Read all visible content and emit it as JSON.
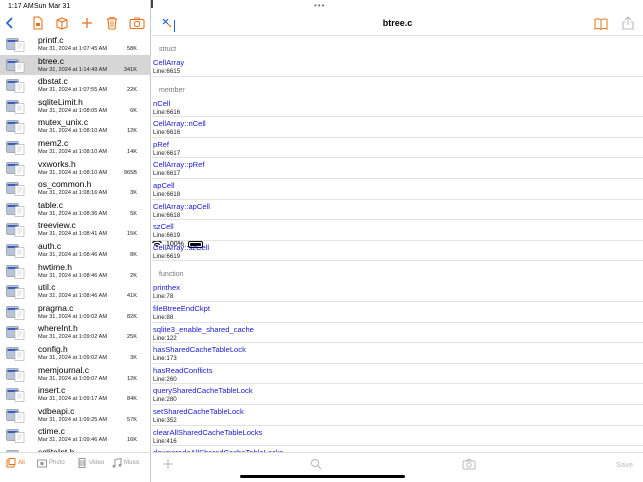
{
  "status": {
    "time": "1:17 AM",
    "date": "Sun Mar 31",
    "battery": "100%"
  },
  "left_toolbar": [
    "back-icon",
    "new-file-icon",
    "package-icon",
    "add-icon",
    "trash-icon",
    "camera-icon"
  ],
  "files": [
    {
      "name": "printf.c",
      "date": "Mar 31, 2024 at 1:07:45 AM",
      "size": "58K",
      "selected": false
    },
    {
      "name": "btree.c",
      "date": "Mar 31, 2024 at 1:14:49 AM",
      "size": "341K",
      "selected": true
    },
    {
      "name": "dbstat.c",
      "date": "Mar 31, 2024 at 1:07:55 AM",
      "size": "22K",
      "selected": false
    },
    {
      "name": "sqliteLimit.h",
      "date": "Mar 31, 2024 at 1:08:05 AM",
      "size": "6K",
      "selected": false
    },
    {
      "name": "mutex_unix.c",
      "date": "Mar 31, 2024 at 1:08:10 AM",
      "size": "12K",
      "selected": false
    },
    {
      "name": "mem2.c",
      "date": "Mar 31, 2024 at 1:08:10 AM",
      "size": "14K",
      "selected": false
    },
    {
      "name": "vxworks.h",
      "date": "Mar 31, 2024 at 1:08:10 AM",
      "size": "965B",
      "selected": false
    },
    {
      "name": "os_common.h",
      "date": "Mar 31, 2024 at 1:08:16 AM",
      "size": "3K",
      "selected": false
    },
    {
      "name": "table.c",
      "date": "Mar 31, 2024 at 1:08:36 AM",
      "size": "5K",
      "selected": false
    },
    {
      "name": "treeview.c",
      "date": "Mar 31, 2024 at 1:08:41 AM",
      "size": "15K",
      "selected": false
    },
    {
      "name": "auth.c",
      "date": "Mar 31, 2024 at 1:08:46 AM",
      "size": "8K",
      "selected": false
    },
    {
      "name": "hwtime.h",
      "date": "Mar 31, 2024 at 1:08:46 AM",
      "size": "2K",
      "selected": false
    },
    {
      "name": "util.c",
      "date": "Mar 31, 2024 at 1:08:46 AM",
      "size": "41K",
      "selected": false
    },
    {
      "name": "pragma.c",
      "date": "Mar 31, 2024 at 1:09:02 AM",
      "size": "82K",
      "selected": false
    },
    {
      "name": "whereInt.h",
      "date": "Mar 31, 2024 at 1:09:02 AM",
      "size": "25K",
      "selected": false
    },
    {
      "name": "config.h",
      "date": "Mar 31, 2024 at 1:09:02 AM",
      "size": "3K",
      "selected": false
    },
    {
      "name": "memjournal.c",
      "date": "Mar 31, 2024 at 1:09:07 AM",
      "size": "12K",
      "selected": false
    },
    {
      "name": "insert.c",
      "date": "Mar 31, 2024 at 1:09:17 AM",
      "size": "84K",
      "selected": false
    },
    {
      "name": "vdbeapi.c",
      "date": "Mar 31, 2024 at 1:09:25 AM",
      "size": "57K",
      "selected": false
    },
    {
      "name": "ctime.c",
      "date": "Mar 31, 2024 at 1:09:46 AM",
      "size": "16K",
      "selected": false
    },
    {
      "name": "sqliteInt.h",
      "date": "",
      "size": "",
      "selected": false
    }
  ],
  "tabs": [
    {
      "label": "All",
      "active": true
    },
    {
      "label": "Photo",
      "active": false
    },
    {
      "label": "Video",
      "active": false
    },
    {
      "label": "Music",
      "active": false
    }
  ],
  "editor": {
    "title": "btree.c",
    "save_label": "Save",
    "sections": [
      {
        "label": "struct",
        "items": [
          {
            "name": "CellArray",
            "line": "Line:6615"
          }
        ]
      },
      {
        "label": "member",
        "items": [
          {
            "name": "nCell",
            "line": "Line:6616"
          },
          {
            "name": "CellArray::nCell",
            "line": "Line:6616"
          },
          {
            "name": "pRef",
            "line": "Line:6617"
          },
          {
            "name": "CellArray::pRef",
            "line": "Line:6617"
          },
          {
            "name": "apCell",
            "line": "Line:6618"
          },
          {
            "name": "CellArray::apCell",
            "line": "Line:6618"
          },
          {
            "name": "szCell",
            "line": "Line:6619"
          },
          {
            "name": "CellArray::szCell",
            "line": "Line:6619"
          }
        ]
      },
      {
        "label": "function",
        "items": [
          {
            "name": "printhex",
            "line": "Line:78"
          },
          {
            "name": "fileBtreeEndCkpt",
            "line": "Line:88"
          },
          {
            "name": "sqlite3_enable_shared_cache",
            "line": "Line:122"
          },
          {
            "name": "hasSharedCacheTableLock",
            "line": "Line:173"
          },
          {
            "name": "hasReadConflicts",
            "line": "Line:260"
          },
          {
            "name": "querySharedCacheTableLock",
            "line": "Line:280"
          },
          {
            "name": "setSharedCacheTableLock",
            "line": "Line:352"
          },
          {
            "name": "clearAllSharedCacheTableLocks",
            "line": "Line:416"
          },
          {
            "name": "downgradeAllSharedCacheTableLocks",
            "line": ""
          }
        ]
      }
    ]
  },
  "colors": {
    "accent": "#e8731b",
    "symbol": "#1a1ad4",
    "selected_row": "#d6d6d6"
  }
}
